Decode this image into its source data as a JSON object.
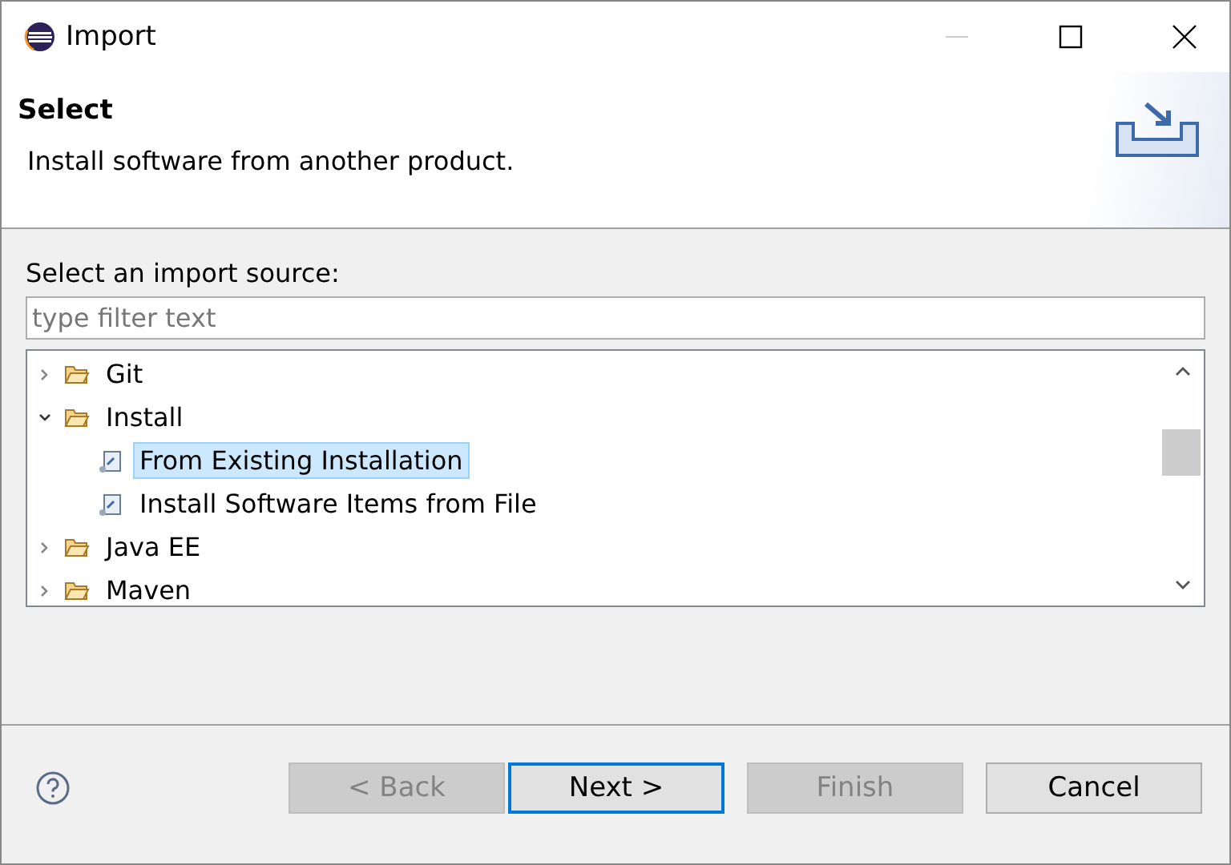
{
  "window": {
    "title": "Import"
  },
  "header": {
    "title": "Select",
    "description": "Install software from another product."
  },
  "source_label": "Select an import source:",
  "filter": {
    "placeholder": "type filter text"
  },
  "tree": [
    {
      "kind": "folder",
      "label": "Git",
      "expanded": false,
      "selected": false
    },
    {
      "kind": "folder",
      "label": "Install",
      "expanded": true,
      "selected": false,
      "children": [
        {
          "kind": "item",
          "label": "From Existing Installation",
          "selected": true
        },
        {
          "kind": "item",
          "label": "Install Software Items from File",
          "selected": false
        }
      ]
    },
    {
      "kind": "folder",
      "label": "Java EE",
      "expanded": false,
      "selected": false
    },
    {
      "kind": "folder",
      "label": "Maven",
      "expanded": false,
      "selected": false
    }
  ],
  "buttons": [
    {
      "label": "< Back",
      "disabled": true,
      "default": false
    },
    {
      "label": "Next >",
      "disabled": false,
      "default": true
    },
    {
      "label": "Finish",
      "disabled": true,
      "default": false
    },
    {
      "label": "Cancel",
      "disabled": false,
      "default": false
    }
  ]
}
